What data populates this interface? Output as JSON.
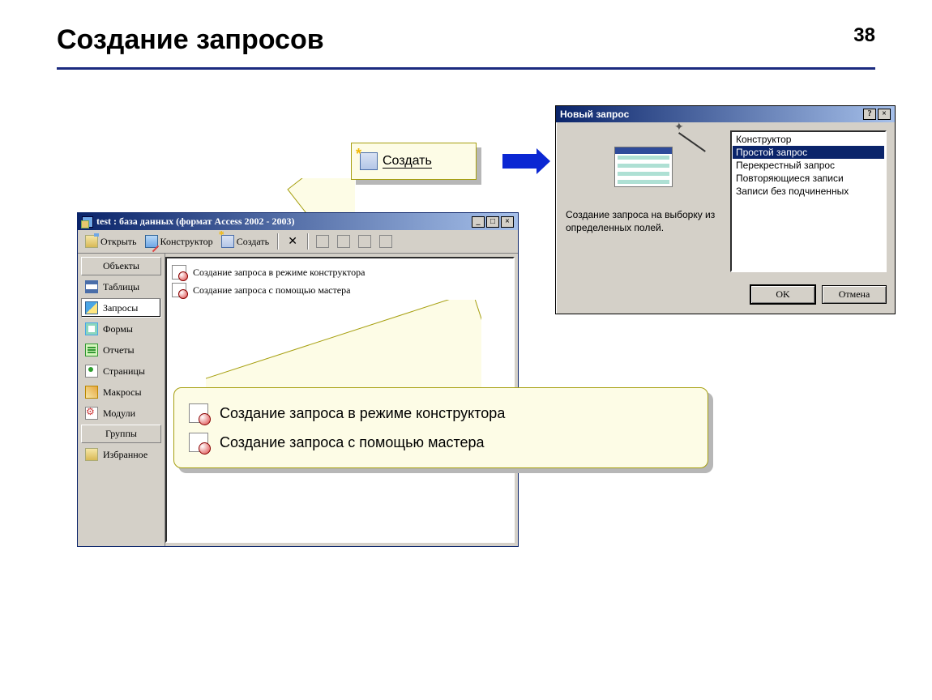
{
  "slide": {
    "title": "Создание запросов",
    "number": "38"
  },
  "callout_create": {
    "label": "Создать"
  },
  "dialog": {
    "title": "Новый запрос",
    "description": "Создание запроса на выборку из определенных полей.",
    "options": [
      "Конструктор",
      "Простой запрос",
      "Перекрестный запрос",
      "Повторяющиеся записи",
      "Записи без подчиненных"
    ],
    "selected_index": 1,
    "ok": "OK",
    "cancel": "Отмена",
    "help_btn": "?",
    "close_btn": "×"
  },
  "dbwin": {
    "title": "test : база данных (формат Access 2002 - 2003)",
    "min_btn": "_",
    "max_btn": "□",
    "close_btn": "×",
    "toolbar": {
      "open": "Открыть",
      "design": "Конструктор",
      "new": "Создать"
    },
    "side": {
      "objects_header": "Объекты",
      "groups_header": "Группы",
      "items": [
        "Таблицы",
        "Запросы",
        "Формы",
        "Отчеты",
        "Страницы",
        "Макросы",
        "Модули"
      ],
      "favorites": "Избранное"
    },
    "main_items": [
      "Создание запроса в режиме конструктора",
      "Создание запроса с помощью мастера"
    ]
  },
  "callout_big": {
    "line1": "Создание запроса в режиме конструктора",
    "line2": "Создание запроса с помощью мастера"
  }
}
